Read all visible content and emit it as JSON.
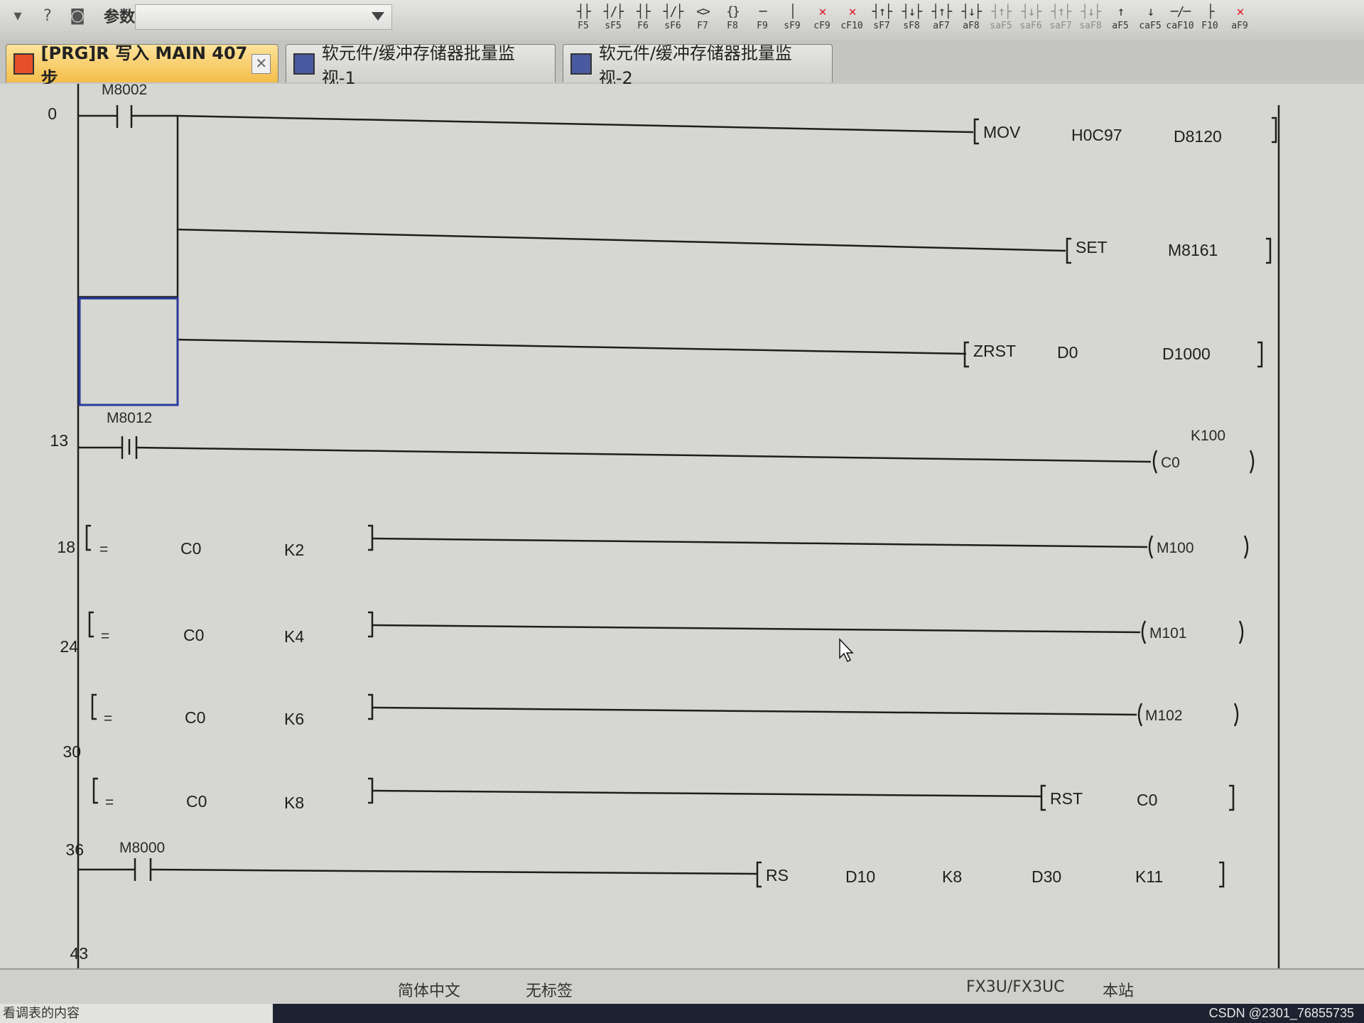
{
  "toolbar": {
    "param_label": "参数",
    "tools": [
      {
        "glyph": "┤├",
        "key": "F5"
      },
      {
        "glyph": "┤/├",
        "key": "sF5"
      },
      {
        "glyph": "┤├",
        "key": "F6"
      },
      {
        "glyph": "┤/├",
        "key": "sF6"
      },
      {
        "glyph": "<>",
        "key": "F7"
      },
      {
        "glyph": "{}",
        "key": "F8"
      },
      {
        "glyph": "─",
        "key": "F9"
      },
      {
        "glyph": "│",
        "key": "sF9"
      },
      {
        "glyph": "✕",
        "key": "cF9"
      },
      {
        "glyph": "✕",
        "key": "cF10"
      },
      {
        "glyph": "┤↑├",
        "key": "sF7"
      },
      {
        "glyph": "┤↓├",
        "key": "sF8"
      },
      {
        "glyph": "┤↑├",
        "key": "aF7"
      },
      {
        "glyph": "┤↓├",
        "key": "aF8"
      },
      {
        "glyph": "┤↑├",
        "key": "saF5"
      },
      {
        "glyph": "┤↓├",
        "key": "saF6"
      },
      {
        "glyph": "┤↑├",
        "key": "saF7"
      },
      {
        "glyph": "┤↓├",
        "key": "saF8"
      },
      {
        "glyph": "↑",
        "key": "aF5"
      },
      {
        "glyph": "↓",
        "key": "caF5"
      },
      {
        "glyph": "─/─",
        "key": "caF10"
      },
      {
        "glyph": "├",
        "key": "F10"
      },
      {
        "glyph": "✕",
        "key": "aF9"
      }
    ]
  },
  "tabs": [
    {
      "label": "[PRG]R 写入 MAIN 407步"
    },
    {
      "label": "软元件/缓冲存储器批量监视-1"
    },
    {
      "label": "软元件/缓冲存储器批量监视-2"
    }
  ],
  "ladder": {
    "rungs": [
      {
        "step": "0",
        "contact": "M8002"
      },
      {
        "step": "13",
        "contact": "M8012"
      },
      {
        "step": "18"
      },
      {
        "step": "24"
      },
      {
        "step": "30"
      },
      {
        "step": "36"
      },
      {
        "step": "43",
        "contact": "M8000"
      }
    ],
    "instructions": {
      "mov": [
        "MOV",
        "H0C97",
        "D8120"
      ],
      "set": [
        "SET",
        "M8161"
      ],
      "zrst": [
        "ZRST",
        "D0",
        "D1000"
      ],
      "counter": {
        "name": "C0",
        "preset": "K100"
      },
      "cmp": [
        {
          "op": "=",
          "a": "C0",
          "b": "K2",
          "coil": "M100"
        },
        {
          "op": "=",
          "a": "C0",
          "b": "K4",
          "coil": "M101"
        },
        {
          "op": "=",
          "a": "C0",
          "b": "K6",
          "coil": "M102"
        },
        {
          "op": "=",
          "a": "C0",
          "b": "K8"
        }
      ],
      "rst": [
        "RST",
        "C0"
      ],
      "rs": [
        "RS",
        "D10",
        "K8",
        "D30",
        "K11"
      ]
    }
  },
  "status": {
    "language": "简体中文",
    "label": "无标签",
    "plc": "FX3U/FX3UC",
    "station": "本站"
  },
  "taskbar": {
    "left_text": "看调表的内容"
  },
  "watermark": "CSDN @2301_76855735",
  "colors": {
    "selection_box": "#2a3a9c",
    "tab_active": "#f4bd4a",
    "cf_red": "#d12"
  }
}
